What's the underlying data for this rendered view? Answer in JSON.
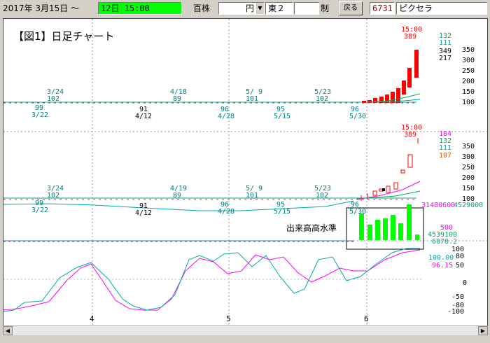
{
  "toolbar": {
    "date": "2017年 3月15日 ～",
    "session": "12日 15:00",
    "unit_label": "百株",
    "currency": "円",
    "market": "東２",
    "blank": "",
    "mode": "制",
    "back_label": "戻る",
    "code": "6731",
    "name": "ピクセラ"
  },
  "chart_title": "【図1】日足チャート",
  "panel1": {
    "time": "15:00",
    "last": "389",
    "ma_labels": [
      "132",
      "111"
    ],
    "scale_top": [
      "349",
      "217"
    ],
    "scale": [
      "350",
      "300",
      "250",
      "200",
      "150",
      "100"
    ],
    "annotations": [
      {
        "text": "3/24",
        "sub": "102"
      },
      {
        "text": "99",
        "sub": "3/22"
      },
      {
        "text": "4/18",
        "sub": "89"
      },
      {
        "text": "91",
        "sub": "4/12"
      },
      {
        "text": "5/ 9",
        "sub": "101"
      },
      {
        "text": "96",
        "sub": "4/28"
      },
      {
        "text": "95",
        "sub": "5/15"
      },
      {
        "text": "5/23",
        "sub": "102"
      },
      {
        "text": "96",
        "sub": "5/30"
      }
    ]
  },
  "panel2": {
    "time": "15:00",
    "last": "389",
    "ma_labels": [
      "184",
      "132",
      "111",
      "107"
    ],
    "scale": [
      "350",
      "300",
      "250",
      "200",
      "150",
      "100"
    ],
    "annotations": [
      {
        "text": "3/24",
        "sub": "102"
      },
      {
        "text": "99",
        "sub": "3/22"
      },
      {
        "text": "4/19",
        "sub": "89"
      },
      {
        "text": "91",
        "sub": "4/12"
      },
      {
        "text": "5/ 9",
        "sub": "101"
      },
      {
        "text": "96",
        "sub": "4/28"
      },
      {
        "text": "95",
        "sub": "5/15"
      },
      {
        "text": "5/23",
        "sub": "102"
      },
      {
        "text": "96",
        "sub": "5/30"
      }
    ]
  },
  "volume": {
    "label": "出来高高水準",
    "v1": "31480600",
    "v2": "4529000",
    "scale_mid": "500",
    "v3": "4539100",
    "v4": "6078.2"
  },
  "oscillator": {
    "scale": [
      "100",
      "80",
      "50",
      "0",
      "-50",
      "-80",
      "-100"
    ],
    "values": [
      "100.00",
      "96.15"
    ],
    "colors": {
      "k": "#ff00ff",
      "d": "#00aaaa"
    }
  },
  "x_axis": [
    "4",
    "5",
    "6"
  ],
  "colors": {
    "up": "#ff0000",
    "accent": "#00ff00",
    "ma1": "#00aa66",
    "ma2": "#ff00ff",
    "label_teal": "#008080"
  }
}
